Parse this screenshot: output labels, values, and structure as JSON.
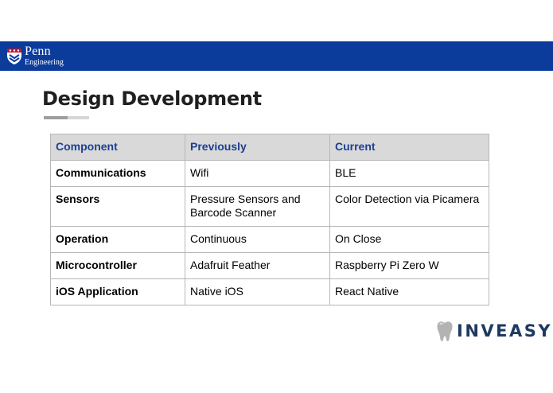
{
  "header": {
    "logo_line1": "Penn",
    "logo_line2": "Engineering",
    "colors": {
      "banner": "#0b3c9c"
    }
  },
  "slide": {
    "title": "Design Development"
  },
  "table": {
    "columns": [
      "Component",
      "Previously",
      "Current"
    ],
    "rows": [
      {
        "component": "Communications",
        "previously": "Wifi",
        "current": "BLE"
      },
      {
        "component": "Sensors",
        "previously": "Pressure Sensors and Barcode Scanner",
        "current": "Color Detection via Picamera"
      },
      {
        "component": "Operation",
        "previously": "Continuous",
        "current": "On Close"
      },
      {
        "component": "Microcontroller",
        "previously": "Adafruit Feather",
        "current": "Raspberry Pi Zero W"
      },
      {
        "component": "iOS Application",
        "previously": "Native iOS",
        "current": "React Native"
      }
    ],
    "colors": {
      "header_bg": "#d9d9d9",
      "header_text": "#1c3f94"
    }
  },
  "brand": {
    "name": "INVEASY",
    "icon": "tooth-icon",
    "color": "#1f3a60"
  }
}
